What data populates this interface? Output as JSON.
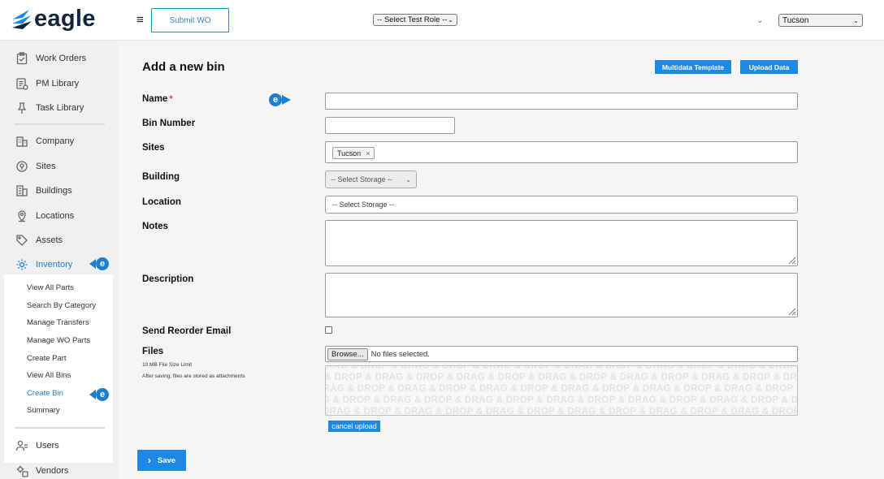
{
  "header": {
    "logo_text": "eagle",
    "menu_icon": "hamburger-icon",
    "submit_wo_label": "Submit WO",
    "role_select_value": "-- Select Test Role --",
    "location_select_value": "Tucson"
  },
  "sidebar": {
    "items": [
      {
        "label": "Work Orders",
        "icon": "clipboard-check-icon"
      },
      {
        "label": "PM Library",
        "icon": "pm-library-icon"
      },
      {
        "label": "Task Library",
        "icon": "pushpin-icon"
      },
      {
        "label": "Company",
        "icon": "building-icon"
      },
      {
        "label": "Sites",
        "icon": "map-pin-icon"
      },
      {
        "label": "Buildings",
        "icon": "buildings-icon"
      },
      {
        "label": "Locations",
        "icon": "location-icon"
      },
      {
        "label": "Assets",
        "icon": "tag-icon"
      },
      {
        "label": "Inventory",
        "icon": "gear-icon"
      },
      {
        "label": "Users",
        "icon": "users-icon"
      },
      {
        "label": "Vendors",
        "icon": "vendors-icon"
      }
    ],
    "inventory_sub": [
      "View All Parts",
      "Search By Category",
      "Manage Transfers",
      "Manage WO Parts",
      "Create Part",
      "View All Bins",
      "Create Bin",
      "Summary"
    ]
  },
  "main": {
    "title": "Add a new bin",
    "multidata_label": "Multidata Template",
    "upload_label": "Upload Data",
    "fields": {
      "name": "Name",
      "required_marker": "*",
      "bin_number": "Bin Number",
      "sites": "Sites",
      "site_tag": "Tucson",
      "site_tag_remove": "×",
      "building": "Building",
      "building_select": "-- Select Storage --",
      "location": "Location",
      "location_select": "-- Select Storage --",
      "notes": "Notes",
      "description": "Description",
      "send_reorder": "Send Reorder Email",
      "files": "Files",
      "file_size_note": "10 MB File Size Limit",
      "attach_note": "After saving, files are stored as attachments",
      "browse_label": "Browse...",
      "no_files": "No files selected.",
      "dropzone_text": "DRAG & DROP & DRAG & DROP & DRAG & DROP & DRAG & DROP & DRAG & DROP & DRAG & DROP & DRAG & DROP & DRAG",
      "cancel_upload": "cancel upload"
    },
    "save_label": "Save"
  },
  "colors": {
    "accent": "#1e88e5",
    "brand_dark": "#13243d",
    "required": "#e53935"
  }
}
